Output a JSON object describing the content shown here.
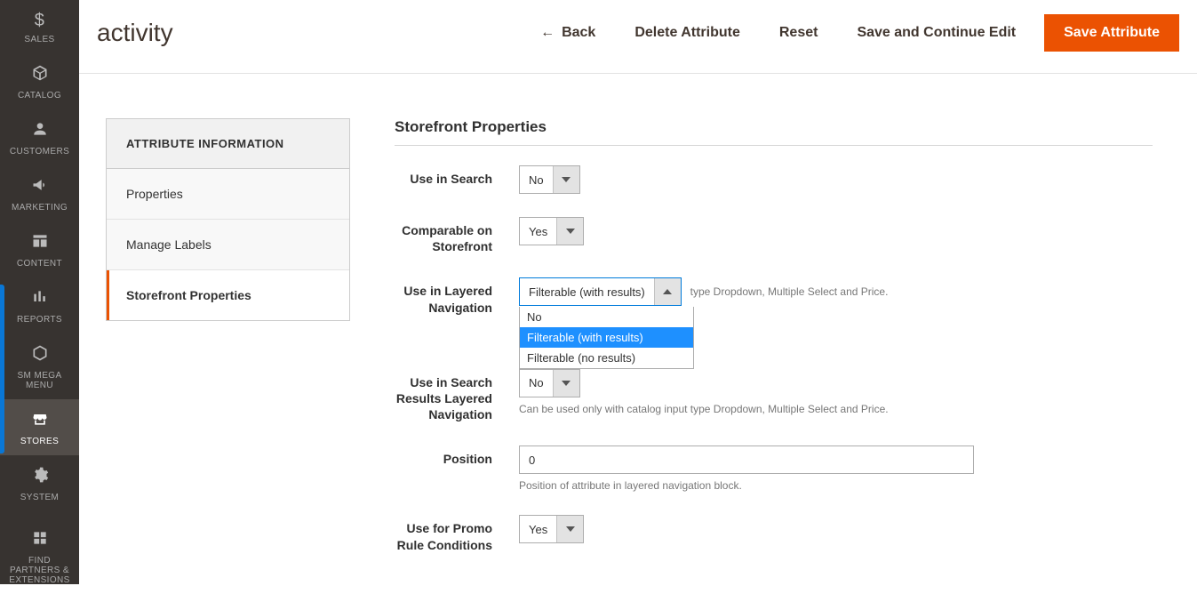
{
  "sidebar": {
    "items": [
      {
        "label": "SALES",
        "icon": "$"
      },
      {
        "label": "CATALOG",
        "icon": "cube"
      },
      {
        "label": "CUSTOMERS",
        "icon": "person"
      },
      {
        "label": "MARKETING",
        "icon": "megaphone"
      },
      {
        "label": "CONTENT",
        "icon": "layout"
      },
      {
        "label": "REPORTS",
        "icon": "bars"
      },
      {
        "label": "SM MEGA MENU",
        "icon": "hex"
      },
      {
        "label": "STORES",
        "icon": "store"
      },
      {
        "label": "SYSTEM",
        "icon": "gear"
      },
      {
        "label": "FIND PARTNERS & EXTENSIONS",
        "icon": "blocks"
      }
    ]
  },
  "header": {
    "title": "activity",
    "actions": {
      "back": "Back",
      "delete": "Delete Attribute",
      "reset": "Reset",
      "save_continue": "Save and Continue Edit",
      "save": "Save Attribute"
    }
  },
  "panel": {
    "title": "ATTRIBUTE INFORMATION",
    "items": {
      "properties": "Properties",
      "manage_labels": "Manage Labels",
      "storefront": "Storefront Properties"
    }
  },
  "form": {
    "section_title": "Storefront Properties",
    "use_in_search": {
      "label": "Use in Search",
      "value": "No"
    },
    "comparable": {
      "label": "Comparable on Storefront",
      "value": "Yes"
    },
    "layered_nav": {
      "label": "Use in Layered Navigation",
      "value": "Filterable (with results)",
      "options": [
        "No",
        "Filterable (with results)",
        "Filterable (no results)"
      ],
      "note_suffix": "type Dropdown, Multiple Select and Price."
    },
    "search_layered": {
      "label": "Use in Search Results Layered Navigation",
      "value": "No",
      "note": "Can be used only with catalog input type Dropdown, Multiple Select and Price."
    },
    "position": {
      "label": "Position",
      "value": "0",
      "note": "Position of attribute in layered navigation block."
    },
    "promo_rule": {
      "label": "Use for Promo Rule Conditions",
      "value": "Yes"
    }
  }
}
